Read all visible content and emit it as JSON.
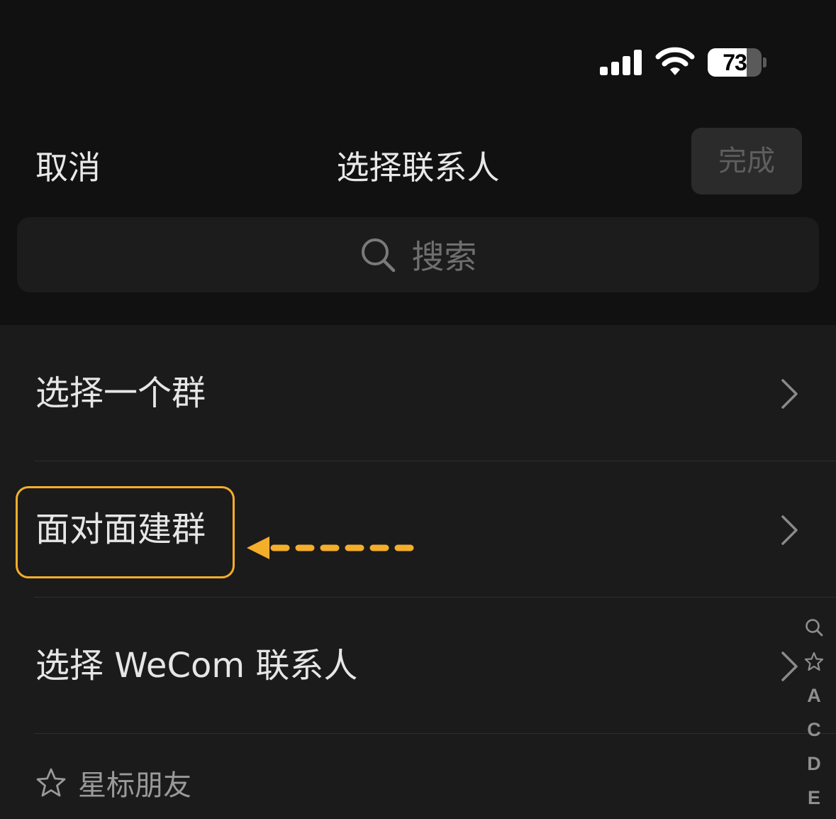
{
  "status_bar": {
    "battery_level": "73",
    "battery_fraction": 0.73,
    "icons": [
      "signal-icon",
      "wifi-icon",
      "battery-icon"
    ]
  },
  "nav": {
    "cancel_label": "取消",
    "title": "选择联系人",
    "done_label": "完成"
  },
  "search": {
    "placeholder": "搜索",
    "icon": "search-icon"
  },
  "list": {
    "items": [
      {
        "label": "选择一个群",
        "icon": "chevron-right-icon"
      },
      {
        "label": "面对面建群",
        "icon": "chevron-right-icon"
      },
      {
        "label": "选择 WeCom 联系人",
        "icon": "chevron-right-icon"
      }
    ],
    "starred_section": {
      "label": "星标朋友",
      "icon": "star-icon"
    }
  },
  "index_bar": {
    "items": [
      "search-icon",
      "star-icon",
      "A",
      "C",
      "D",
      "E"
    ]
  },
  "annotation": {
    "color": "#f5ae2a",
    "icon": "dashed-arrow-left-icon"
  },
  "colors": {
    "background": "#111111",
    "list_background": "#1b1b1b",
    "text": "#e6e6e6",
    "muted": "#6f6f6f",
    "highlight": "#f5ae2a"
  }
}
